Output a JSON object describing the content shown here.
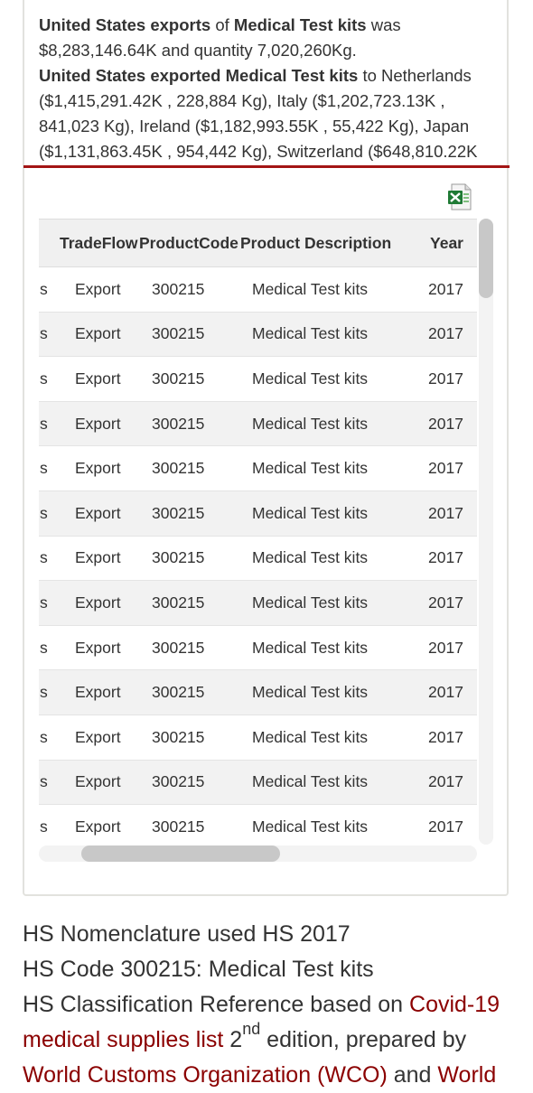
{
  "summary": {
    "line1_bold1": "United States exports",
    "line1_text1": " of ",
    "line1_bold2": "Medical Test kits",
    "line1_text2": " was $8,283,146.64K and quantity 7,020,260Kg.",
    "line2_bold": "United States exported Medical Test kits",
    "line2_text": " to Netherlands ($1,415,291.42K , 228,884 Kg), Italy ($1,202,723.13K , 841,023 Kg), Ireland ($1,182,993.55K , 55,422 Kg), Japan ($1,131,863.45K , 954,442 Kg), Switzerland ($648,810.22K"
  },
  "export_icon": "excel-icon",
  "table": {
    "headers": [
      "",
      "TradeFlow",
      "ProductCode",
      "Product Description",
      "Year"
    ],
    "rows": [
      [
        "s",
        "Export",
        "300215",
        "Medical Test kits",
        "2017"
      ],
      [
        "s",
        "Export",
        "300215",
        "Medical Test kits",
        "2017"
      ],
      [
        "s",
        "Export",
        "300215",
        "Medical Test kits",
        "2017"
      ],
      [
        "s",
        "Export",
        "300215",
        "Medical Test kits",
        "2017"
      ],
      [
        "s",
        "Export",
        "300215",
        "Medical Test kits",
        "2017"
      ],
      [
        "s",
        "Export",
        "300215",
        "Medical Test kits",
        "2017"
      ],
      [
        "s",
        "Export",
        "300215",
        "Medical Test kits",
        "2017"
      ],
      [
        "s",
        "Export",
        "300215",
        "Medical Test kits",
        "2017"
      ],
      [
        "s",
        "Export",
        "300215",
        "Medical Test kits",
        "2017"
      ],
      [
        "s",
        "Export",
        "300215",
        "Medical Test kits",
        "2017"
      ],
      [
        "s",
        "Export",
        "300215",
        "Medical Test kits",
        "2017"
      ],
      [
        "s",
        "Export",
        "300215",
        "Medical Test kits",
        "2017"
      ],
      [
        "s",
        "Export",
        "300215",
        "Medical Test kits",
        "2017"
      ]
    ]
  },
  "notes": {
    "nomenclature": "HS Nomenclature used HS 2017",
    "hs_code": "HS Code 300215: Medical Test kits",
    "reference_prefix": "HS Classification Reference based on ",
    "link_covid": "Covid-19",
    "link_covid_2": "medical supplies list",
    "edition_num": " 2",
    "edition_sup": "nd",
    "edition_rest": " edition, prepared by",
    "link_wco": "World Customs Organization (WCO)",
    "and_text": " and ",
    "link_world": "World"
  },
  "colors": {
    "accent_red": "#a31515",
    "link": "#8b0000",
    "row_alt": "#f2f2f2"
  }
}
